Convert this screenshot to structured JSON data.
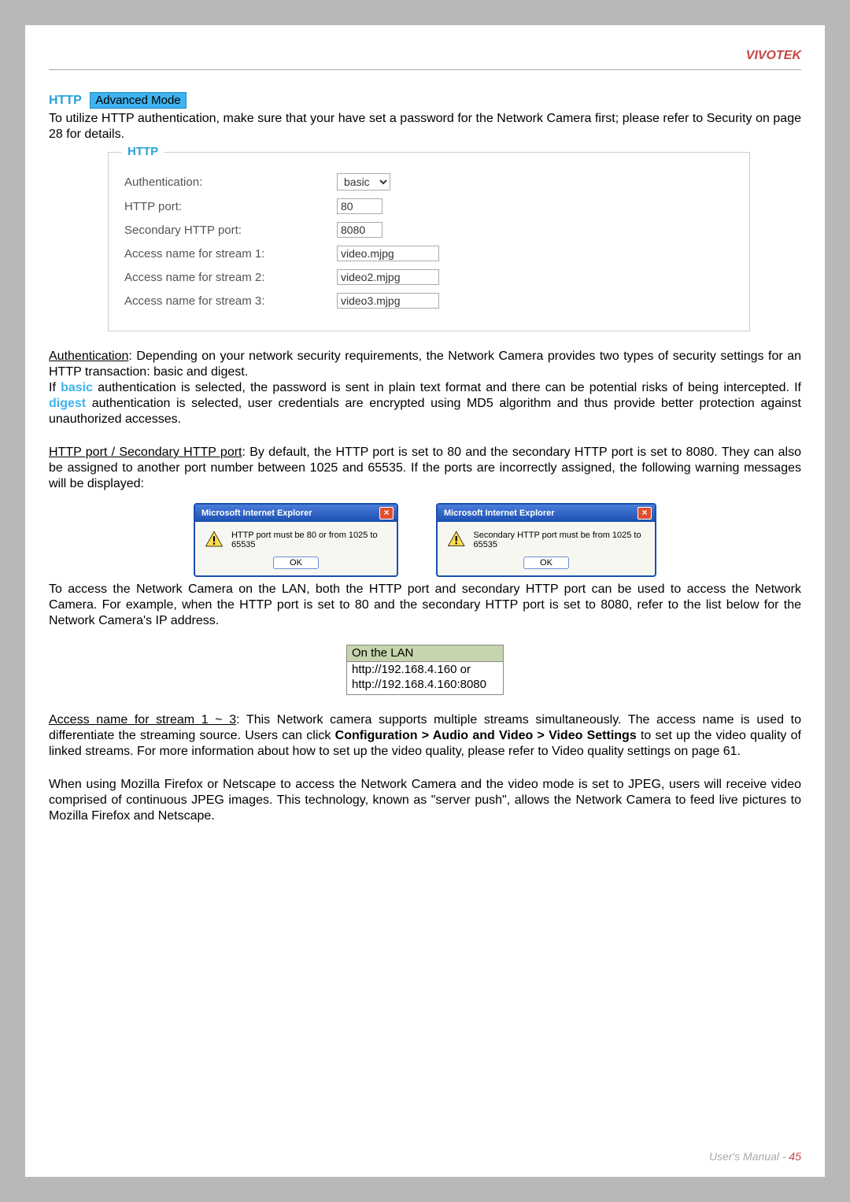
{
  "header": {
    "brand": "VIVOTEK"
  },
  "section": {
    "http": "HTTP",
    "mode": "Advanced Mode",
    "intro": "To utilize HTTP authentication, make sure that your have set a password for the Network Camera first; please refer to Security on page 28 for details."
  },
  "form": {
    "legend": "HTTP",
    "rows": [
      {
        "label": "Authentication:",
        "type": "select",
        "value": "basic"
      },
      {
        "label": "HTTP port:",
        "type": "input-small",
        "value": "80"
      },
      {
        "label": "Secondary HTTP port:",
        "type": "input-small",
        "value": "8080"
      },
      {
        "label": "Access name for stream 1:",
        "type": "input-med",
        "value": "video.mjpg"
      },
      {
        "label": "Access name for stream 2:",
        "type": "input-med",
        "value": "video2.mjpg"
      },
      {
        "label": "Access name for stream 3:",
        "type": "input-med",
        "value": "video3.mjpg"
      }
    ]
  },
  "auth": {
    "head": "Authentication",
    "text1": ": Depending on your network security requirements, the Network Camera provides two types of security settings for an HTTP transaction: basic and digest.",
    "text2a": "If ",
    "basic": "basic",
    "text2b": " authentication is selected, the password is sent in plain text format and there can be potential risks of being intercepted. If ",
    "digest": "digest",
    "text2c": " authentication is selected, user credentials are encrypted using MD5 algorithm and thus provide better protection against unauthorized accesses."
  },
  "ports": {
    "head": "HTTP port / Secondary HTTP port",
    "text": ": By default, the HTTP port is set to 80 and the secondary HTTP port is set to 8080. They can also be assigned to another port number between 1025 and 65535. If the ports are incorrectly assigned, the following warning messages will be displayed:"
  },
  "dialog1": {
    "title": "Microsoft Internet Explorer",
    "msg": "HTTP port must be 80 or from 1025 to 65535",
    "ok": "OK"
  },
  "dialog2": {
    "title": "Microsoft Internet Explorer",
    "msg": "Secondary HTTP port must be from 1025 to 65535",
    "ok": "OK"
  },
  "lanpara": "To access the Network Camera on the LAN, both the HTTP port and secondary HTTP port can be used to access the Network Camera. For example, when the HTTP port is set to 80 and the secondary HTTP port is set to 8080, refer to the list below for the Network Camera's IP address.",
  "lan": {
    "head": "On the LAN",
    "line1": "http://192.168.4.160  or",
    "line2": "http://192.168.4.160:8080"
  },
  "access": {
    "head": "Access name for stream 1 ~ 3",
    "text1": ": This Network camera supports multiple streams simultaneously. The access name is used to differentiate the streaming source. Users can click ",
    "bold": "Configuration > Audio and Video > Video Settings",
    "text2": " to set up the video quality of linked streams. For more information about how to set up the video quality, please refer to Video quality settings on page 61."
  },
  "mozilla": "When using Mozilla Firefox or Netscape to access the Network Camera and the video mode is set to JPEG, users will receive video comprised of continuous JPEG images. This technology, known as \"server push\", allows the Network Camera to feed live pictures to Mozilla Firefox and Netscape.",
  "footer": {
    "label": "User's Manual - ",
    "page": "45"
  }
}
